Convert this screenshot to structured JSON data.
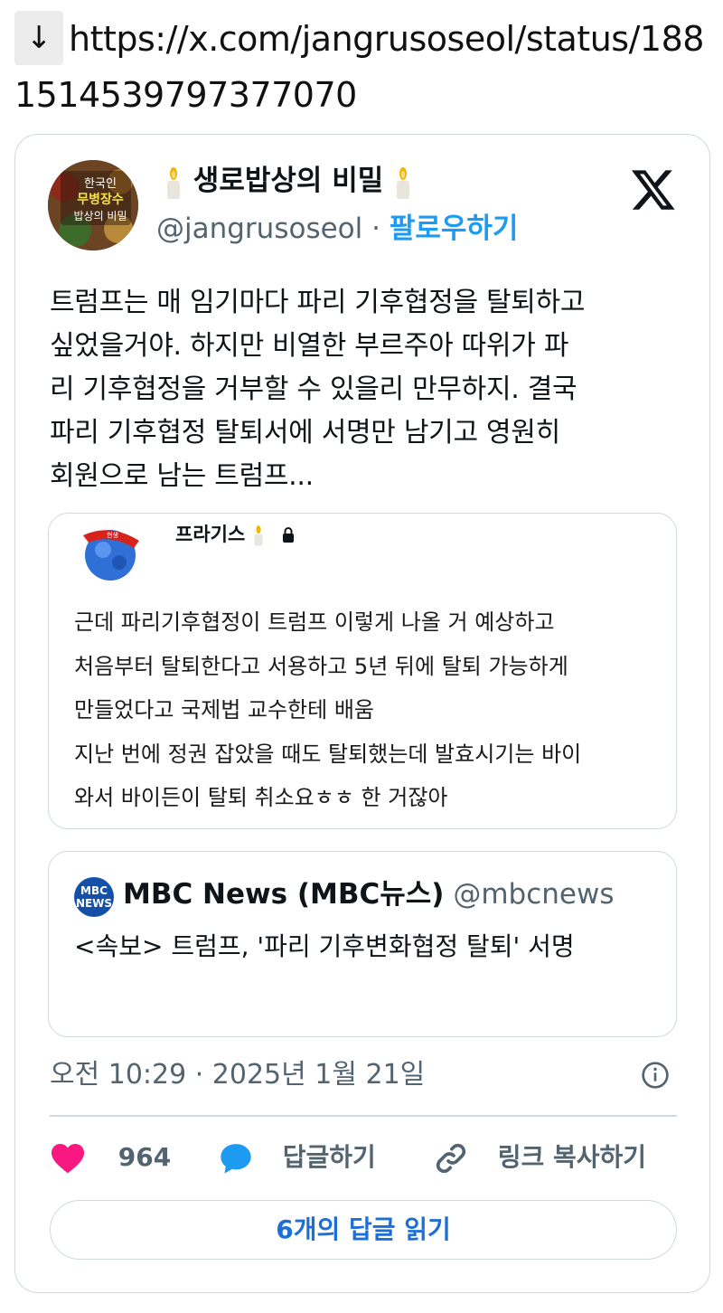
{
  "url_line": {
    "arrow": "↓",
    "text": "https://x.com/jangrusoseol/status/1881514539797377070"
  },
  "tweet": {
    "display_name": "생로밥상의 비밀",
    "handle": "@jangrusoseol",
    "separator": "·",
    "follow_label": "팔로우하기",
    "avatar_text": [
      "한국인",
      "무병장수",
      "밥상의 비밀"
    ],
    "text_lines": [
      "트럼프는 매 임기마다 파리 기후협정을 탈퇴하고",
      "싶었을거야. 하지만 비열한 부르주아 따위가 파",
      "리 기후협정을 거부할 수 있을리 만무하지. 결국",
      "파리 기후협정 탈퇴서에 서명만 남기고 영원히",
      "회원으로 남는 트럼프..."
    ],
    "quote": {
      "name": "프라기스",
      "badge": "현생",
      "lines": [
        "근데 파리기후협정이 트럼프 이렇게 나올 거 예상하고",
        "처음부터 탈퇴한다고 서용하고 5년 뒤에 탈퇴 가능하게",
        "만들었다고 국제법 교수한테 배움",
        "지난 번에 정권 잡았을 때도 탈퇴했는데 발효시기는 바이",
        "와서 바이든이 탈퇴 취소요ㅎㅎ 한 거잖아"
      ]
    },
    "embedded": {
      "logo_text": "MBC NEWS",
      "name": "MBC News (MBC뉴스)",
      "handle": "@mbcnews",
      "text": "<속보> 트럼프, '파리 기후변화협정 탈퇴' 서명"
    },
    "timestamp": "오전 10:29 · 2025년 1월 21일",
    "likes": "964",
    "reply_label": "답글하기",
    "copy_label": "링크 복사하기",
    "read_replies_label": "6개의 답글 읽기"
  },
  "colors": {
    "accent_blue": "#1d9bf0",
    "like_pink": "#f91880",
    "reply_blue": "#1d9bf0",
    "muted": "#536471",
    "border": "#cfd9de"
  },
  "icons": [
    "down-arrow-icon",
    "candle-icon",
    "x-logo-icon",
    "lock-icon",
    "info-icon",
    "heart-icon",
    "speech-bubble-icon",
    "link-icon"
  ]
}
